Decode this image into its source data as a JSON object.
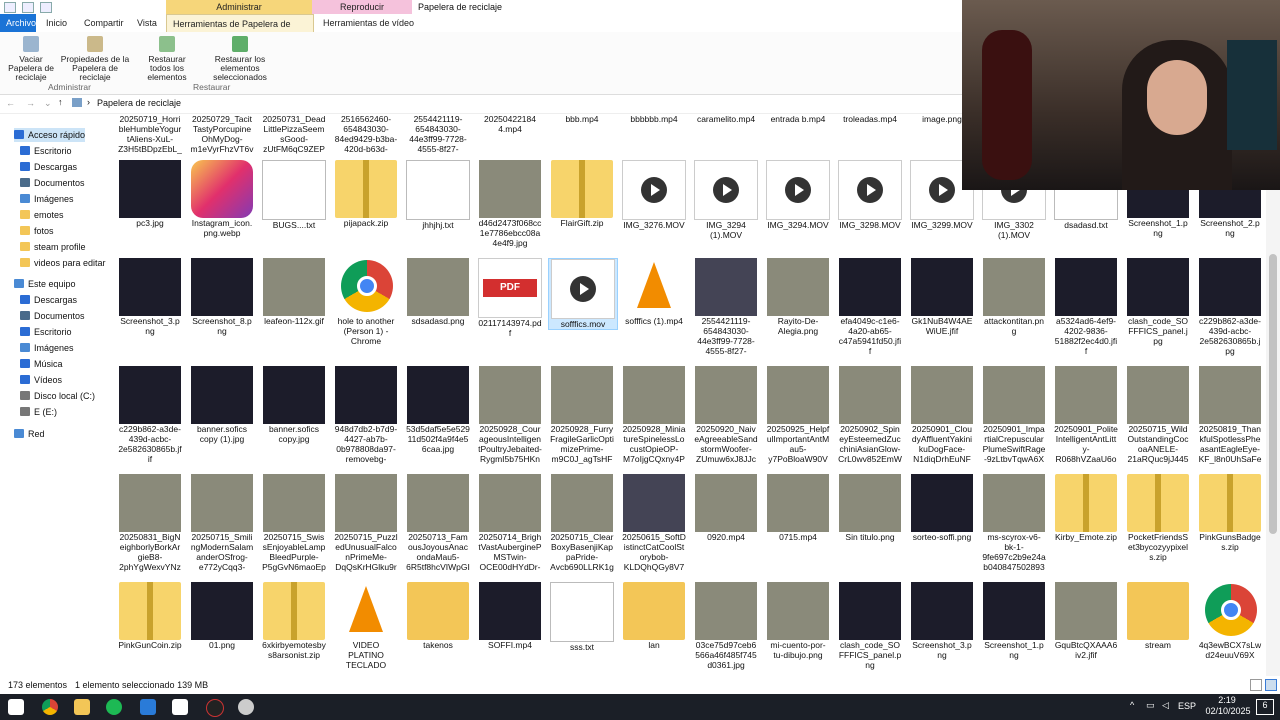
{
  "window": {
    "title": "Papelera de reciclaje",
    "context_admin": "Administrar",
    "context_play": "Reproducir"
  },
  "tabs": {
    "file": "Archivo",
    "home": "Inicio",
    "share": "Compartir",
    "view": "Vista",
    "recycle_tools": "Herramientas de Papelera de reciclaje",
    "video_tools": "Herramientas de vídeo"
  },
  "ribbon": {
    "empty_bin": "Vaciar Papelera de reciclaje",
    "bin_props": "Propiedades de la Papelera de reciclaje",
    "restore_all": "Restaurar todos los elementos",
    "restore_selected": "Restaurar los elementos seleccionados",
    "group_manage": "Administrar",
    "group_restore": "Restaurar"
  },
  "address": {
    "path": "Papelera de reciclaje"
  },
  "nav": {
    "quick_access": "Acceso rápido",
    "items": [
      {
        "label": "Escritorio",
        "icon": "desktop-icon",
        "color": "#2b6cd4"
      },
      {
        "label": "Descargas",
        "icon": "download-icon",
        "color": "#2b6cd4"
      },
      {
        "label": "Documentos",
        "icon": "documents-icon",
        "color": "#4a6b8a"
      },
      {
        "label": "Imágenes",
        "icon": "images-icon",
        "color": "#4a8ad4"
      },
      {
        "label": "emotes",
        "icon": "folder-icon",
        "color": "#f3c657"
      },
      {
        "label": "fotos",
        "icon": "folder-icon",
        "color": "#f3c657"
      },
      {
        "label": "steam profile",
        "icon": "folder-icon",
        "color": "#f3c657"
      },
      {
        "label": "videos para editar",
        "icon": "folder-icon",
        "color": "#f3c657"
      }
    ],
    "this_pc": "Este equipo",
    "pc_items": [
      {
        "label": "Descargas",
        "icon": "download-icon",
        "color": "#2b6cd4"
      },
      {
        "label": "Documentos",
        "icon": "documents-icon",
        "color": "#4a6b8a"
      },
      {
        "label": "Escritorio",
        "icon": "desktop-icon",
        "color": "#2b6cd4"
      },
      {
        "label": "Imágenes",
        "icon": "images-icon",
        "color": "#4a8ad4"
      },
      {
        "label": "Música",
        "icon": "music-icon",
        "color": "#2b6cd4"
      },
      {
        "label": "Vídeos",
        "icon": "videos-icon",
        "color": "#2b6cd4"
      },
      {
        "label": "Disco local (C:)",
        "icon": "disk-icon",
        "color": "#777"
      },
      {
        "label": "E (E:)",
        "icon": "disk-icon",
        "color": "#777"
      }
    ],
    "network": "Red"
  },
  "rows": [
    [
      {
        "name": "20250719_HorribleHumbleYogurtAliens-XuL-Z3H5tBDpzEbL_portra...",
        "kind": "none"
      },
      {
        "name": "20250729_TacitTastyPorcupineOhMyDog-m1eVyrFhzVT6vVv-_port...",
        "kind": "none"
      },
      {
        "name": "20250731_DeadLittlePizzaSeemsGood-zUtFM6qC9ZEPoEkp_portrait...",
        "kind": "none"
      },
      {
        "name": "2516562460-654843030-84ed9429-b3ba-420d-b63d-571abbbee69c....",
        "kind": "none"
      },
      {
        "name": "2554421119-654843030-44e3ff99-7728-4555-8f27-bf661189fde7.mp4",
        "kind": "none"
      },
      {
        "name": "20250422184 4.mp4",
        "kind": "none"
      },
      {
        "name": "bbb.mp4",
        "kind": "none"
      },
      {
        "name": "bbbbbb.mp4",
        "kind": "none"
      },
      {
        "name": "caramelito.mp4",
        "kind": "none"
      },
      {
        "name": "entrada b.mp4",
        "kind": "none"
      },
      {
        "name": "troleadas.mp4",
        "kind": "none"
      },
      {
        "name": "image.png",
        "kind": "none"
      }
    ],
    [
      {
        "name": "pc3.jpg",
        "kind": "img"
      },
      {
        "name": "Instagram_icon.png.webp",
        "kind": "insta"
      },
      {
        "name": "BUGS....txt",
        "kind": "doc"
      },
      {
        "name": "pijapack.zip",
        "kind": "zip"
      },
      {
        "name": "jhhjhj.txt",
        "kind": "doc"
      },
      {
        "name": "d46d2473f068cc1e7786ebcc08a4e4f9.jpg",
        "kind": "photo"
      },
      {
        "name": "FlairGift.zip",
        "kind": "zip"
      },
      {
        "name": "IMG_3276.MOV",
        "kind": "play"
      },
      {
        "name": "IMG_3294 (1).MOV",
        "kind": "play"
      },
      {
        "name": "IMG_3294.MOV",
        "kind": "play"
      },
      {
        "name": "IMG_3298.MOV",
        "kind": "play"
      },
      {
        "name": "IMG_3299.MOV",
        "kind": "play"
      },
      {
        "name": "IMG_3302 (1).MOV",
        "kind": "play"
      },
      {
        "name": "dsadasd.txt",
        "kind": "doc"
      },
      {
        "name": "Screenshot_1.png",
        "kind": "img"
      },
      {
        "name": "Screenshot_2.png",
        "kind": "img"
      }
    ],
    [
      {
        "name": "Screenshot_3.png",
        "kind": "img"
      },
      {
        "name": "Screenshot_8.png",
        "kind": "img"
      },
      {
        "name": "leafeon-112x.gif",
        "kind": "photo"
      },
      {
        "name": "hole to another (Person 1) - Chrome",
        "kind": "chrome"
      },
      {
        "name": "sdsadasd.png",
        "kind": "photo"
      },
      {
        "name": "02117143974.pdf",
        "kind": "pdf"
      },
      {
        "name": "sofffics.mov",
        "kind": "play",
        "selected": true
      },
      {
        "name": "sofffics (1).mp4",
        "kind": "vlc"
      },
      {
        "name": "2554421119-654843030-44e3ff99-7728-4555-8f27-bf661189fde7.mp4",
        "kind": "video"
      },
      {
        "name": "Rayito-De-Alegia.png",
        "kind": "photo"
      },
      {
        "name": "efa4049c-c1e6-4a20-ab65-c47a5941fd50.jfif",
        "kind": "img"
      },
      {
        "name": "Gk1NuB4W4AEWiUE.jfif",
        "kind": "img"
      },
      {
        "name": "attackontitan.png",
        "kind": "photo"
      },
      {
        "name": "a5324ad6-4ef9-4202-9836-51882f2ec4d0.jfif",
        "kind": "img"
      },
      {
        "name": "clash_code_SOFFFICS_panel.jpg",
        "kind": "img"
      },
      {
        "name": "c229b862-a3de-439d-acbc-2e582630865b.jpg",
        "kind": "img"
      }
    ],
    [
      {
        "name": "c229b862-a3de-439d-acbc-2e582630865b.jfif",
        "kind": "img"
      },
      {
        "name": "banner.sofics copy (1).jpg",
        "kind": "img"
      },
      {
        "name": "banner.sofics copy.jpg",
        "kind": "img"
      },
      {
        "name": "948d7db2-b7d9-4427-ab7b-0b978808da97-removebg-preview.png",
        "kind": "img"
      },
      {
        "name": "53d5daf5e5e52911d502f4a9f4e56caa.jpg",
        "kind": "img"
      },
      {
        "name": "20250928_CourageousIntelligentPoultryJebaited-RygmI5b75HKnswn...",
        "kind": "photo"
      },
      {
        "name": "20250928_FurryFragileGarlicOptimizePrime-m9C0J_agTsHF2fsd_por...",
        "kind": "photo"
      },
      {
        "name": "20250928_MiniatureSpinelessLocustOpieOP-M7oIjgCQxny4P7Lh_p...",
        "kind": "photo"
      },
      {
        "name": "20250920_NaiveAgreeableSandstormWoofer-ZUmuw6xJ8JJcLkr_po...",
        "kind": "photo"
      },
      {
        "name": "20250925_HelpfulImportantAntMau5-y7PoBloaW90VBSOu_portra...",
        "kind": "photo"
      },
      {
        "name": "20250902_SpineyEsteemedZucchiniAsianGlow-CrL0wv852EmWq_...",
        "kind": "photo"
      },
      {
        "name": "20250901_CloudyAffluentYakinikuDogFace-N1diqDrhEuNFMPMR_...",
        "kind": "photo"
      },
      {
        "name": "20250901_ImpartialCrepuscularPlumeSwiftRage-9zLtbvTqwA6XN...",
        "kind": "photo"
      },
      {
        "name": "20250901_PoliteIntelligentAntLitty-R068hVZaaU6oGbyz_portrait.mp4",
        "kind": "photo"
      },
      {
        "name": "20250715_WildOutstandingCocoaANELE-21aRQuc9jJ445GVw_port...",
        "kind": "photo"
      },
      {
        "name": "20250819_ThankfulSpotlessPheasantEagleEye-KF_l8n0UhSaFeD8c_...",
        "kind": "photo"
      }
    ],
    [
      {
        "name": "20250831_BigNeighborlyBorkArgieB8-2phYgWexvYNzuyiW_portr...",
        "kind": "photo"
      },
      {
        "name": "20250715_SmilingModernSalamanderOSfrog-e772yCqq3-JsUCKR...",
        "kind": "photo"
      },
      {
        "name": "20250715_SwissEnjoyableLampBleedPurple-P5gGvN6maoEpZX1o...",
        "kind": "photo"
      },
      {
        "name": "20250715_PuzzledUnusualFalconPrimeMe-DqQsKrHGlku9rWGB_p...",
        "kind": "photo"
      },
      {
        "name": "20250713_FamousJoyousAnacondaMau5-6R5tf8hcVIWpGI1Z_port...",
        "kind": "photo"
      },
      {
        "name": "20250714_BrightVastAuberginePMSTwin-OCE00dHYdDr-e9q_portr...",
        "kind": "photo"
      },
      {
        "name": "20250715_ClearBoxyBasenjiKappaPride-Avcb690LLRK1g8KQ_portr...",
        "kind": "photo"
      },
      {
        "name": "20250615_SoftDistinctCatCoolStorybob-KLDQhQGy8V7Q-BHA_sou...",
        "kind": "video"
      },
      {
        "name": "0920.mp4",
        "kind": "photo"
      },
      {
        "name": "0715.mp4",
        "kind": "photo"
      },
      {
        "name": "Sin titulo.png",
        "kind": "photo"
      },
      {
        "name": "sorteo-soffi.png",
        "kind": "img"
      },
      {
        "name": "ms-scyrox-v6-bk-1-9fe697c2b9e24ab04084750289342 98-1024-1024...",
        "kind": "photo"
      },
      {
        "name": "Kirby_Emote.zip",
        "kind": "zip"
      },
      {
        "name": "PocketFriendsSet3bycozyypixels.zip",
        "kind": "zip"
      },
      {
        "name": "PinkGunsBadges.zip",
        "kind": "zip"
      }
    ],
    [
      {
        "name": "PinkGunCoin.zip",
        "kind": "zip"
      },
      {
        "name": "01.png",
        "kind": "img"
      },
      {
        "name": "6xkirbyemotesbys8arsonist.zip",
        "kind": "zip"
      },
      {
        "name": "VIDEO PLATINO TECLADO",
        "kind": "vlc"
      },
      {
        "name": "takenos",
        "kind": "fold"
      },
      {
        "name": "SOFFI.mp4",
        "kind": "img"
      },
      {
        "name": "sss.txt",
        "kind": "doc"
      },
      {
        "name": "lan",
        "kind": "fold"
      },
      {
        "name": "03ce75d97ceb6566a46f485f745d0361.jpg",
        "kind": "photo"
      },
      {
        "name": "mi-cuento-por-tu-dibujo.png",
        "kind": "photo"
      },
      {
        "name": "clash_code_SOFFFICS_panel.png",
        "kind": "img"
      },
      {
        "name": "Screenshot_3.png",
        "kind": "img"
      },
      {
        "name": "Screenshot_1.png",
        "kind": "img"
      },
      {
        "name": "GquBtcQXAAA6iv2.jfif",
        "kind": "photo"
      },
      {
        "name": "stream",
        "kind": "fold"
      },
      {
        "name": "4q3ewBCX7sLwd24euuV69X",
        "kind": "chrome"
      }
    ]
  ],
  "status": {
    "count": "173 elementos",
    "selected": "1 elemento seleccionado  139 MB"
  },
  "taskbar": {
    "lang": "ESP",
    "time": "2:19",
    "date": "02/10/2025",
    "notif": "6"
  },
  "colors": {
    "file_tab": "#1a73d6",
    "selection": "#cce8ff",
    "taskbar": "#1b1f27"
  }
}
